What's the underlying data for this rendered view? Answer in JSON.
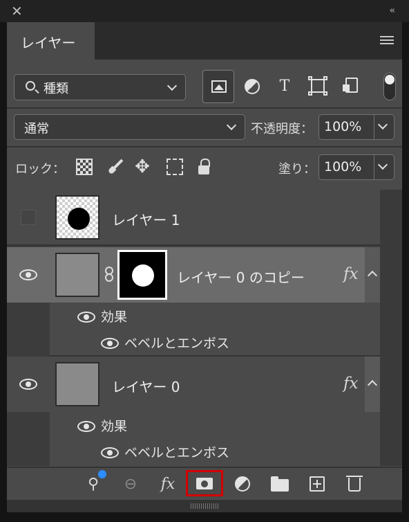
{
  "panel": {
    "tab_label": "レイヤー"
  },
  "filter": {
    "kind_label": "種類"
  },
  "blend": {
    "mode": "通常",
    "opacity_label": "不透明度：",
    "opacity_value": "100%"
  },
  "lock": {
    "label": "ロック：",
    "fill_label": "塗り：",
    "fill_value": "100%"
  },
  "layers": [
    {
      "name": "レイヤー 1",
      "visible": false
    },
    {
      "name": "レイヤー 0 のコピー",
      "visible": true,
      "selected": true,
      "fx": "fx",
      "effects_label": "効果",
      "effect": "ベベルとエンボス"
    },
    {
      "name": "レイヤー 0",
      "visible": true,
      "fx": "fx",
      "effects_label": "効果",
      "effect": "ベベルとエンボス"
    }
  ],
  "toolbar": {
    "fx_label": "fx"
  },
  "colors": {
    "highlight": "#d40000",
    "accent": "#2d8cff"
  }
}
